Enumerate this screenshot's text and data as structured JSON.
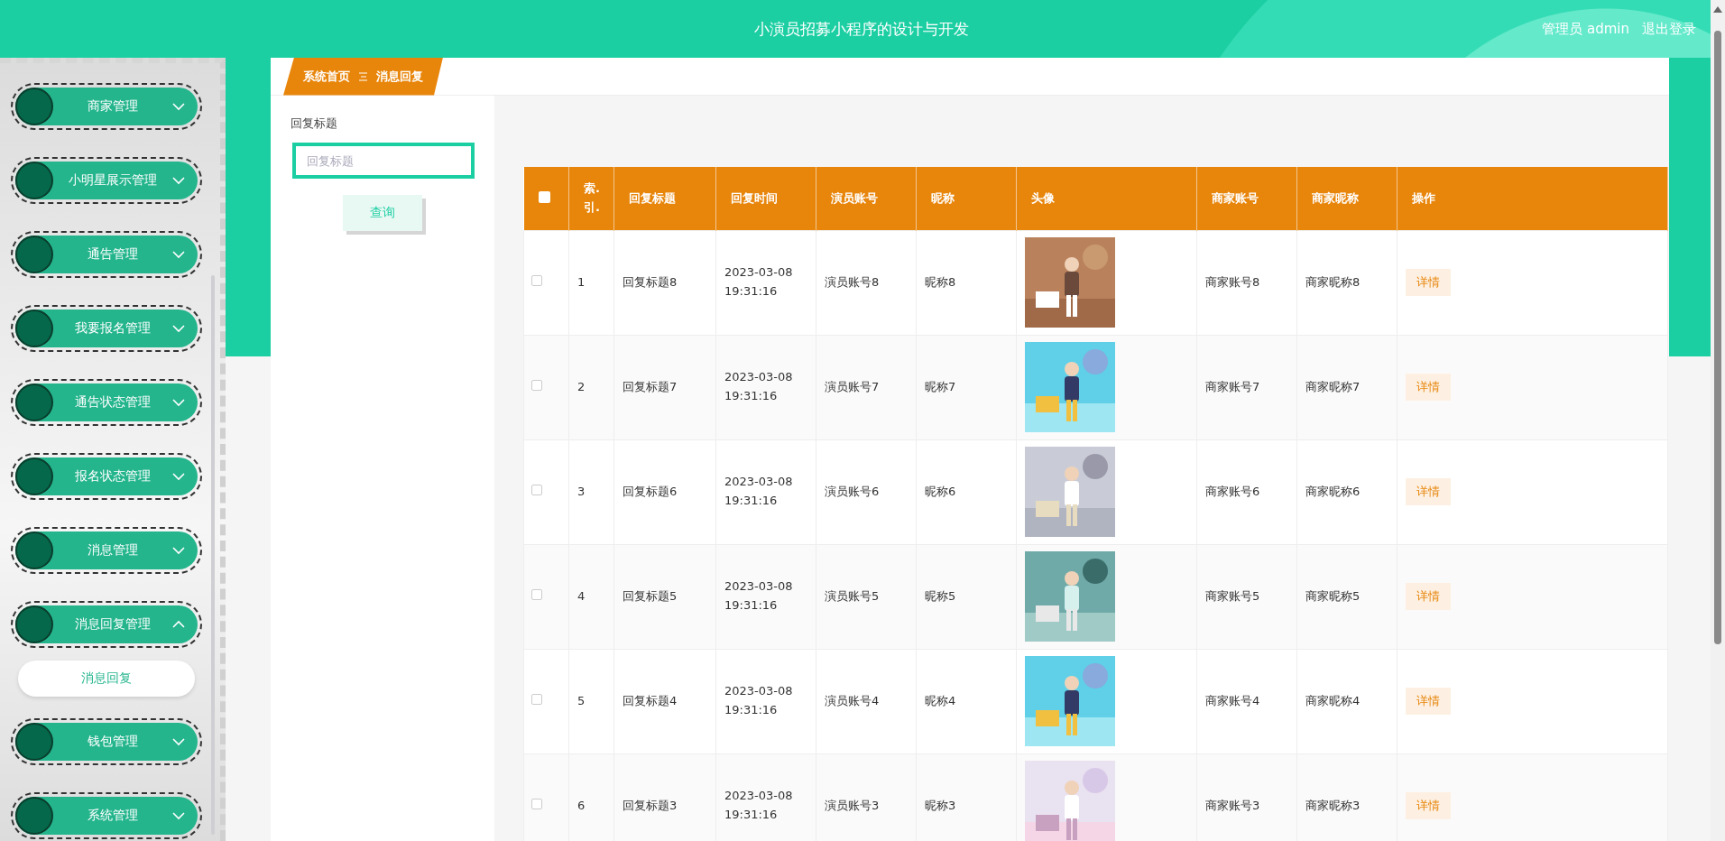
{
  "header": {
    "title": "小演员招募小程序的设计与开发",
    "user": "管理员 admin",
    "logout": "退出登录"
  },
  "sidebar": {
    "items": [
      {
        "label": "商家管理",
        "expanded": false
      },
      {
        "label": "小明星展示管理",
        "expanded": false
      },
      {
        "label": "通告管理",
        "expanded": false
      },
      {
        "label": "我要报名管理",
        "expanded": false
      },
      {
        "label": "通告状态管理",
        "expanded": false
      },
      {
        "label": "报名状态管理",
        "expanded": false
      },
      {
        "label": "消息管理",
        "expanded": false
      },
      {
        "label": "消息回复管理",
        "expanded": true,
        "children": [
          {
            "label": "消息回复",
            "selected": true
          }
        ]
      },
      {
        "label": "钱包管理",
        "expanded": false
      },
      {
        "label": "系统管理",
        "expanded": false
      }
    ]
  },
  "breadcrumb": [
    "系统首页",
    "消息回复"
  ],
  "search": {
    "label": "回复标题",
    "placeholder": "回复标题",
    "button": "查询"
  },
  "table": {
    "select_all": {
      "checked": false
    },
    "columns": [
      "索.引.",
      "回复标题",
      "回复时间",
      "演员账号",
      "昵称",
      "头像",
      "商家账号",
      "商家昵称",
      "操作"
    ],
    "rows": [
      {
        "checked": false,
        "index": "1",
        "title": "回复标题8",
        "time": "2023-03-08 19:31:16",
        "actor": "演员账号8",
        "nickname": "昵称8",
        "merchant": "商家账号8",
        "merchant_name": "商家昵称8",
        "action": "详情"
      },
      {
        "checked": false,
        "index": "2",
        "title": "回复标题7",
        "time": "2023-03-08 19:31:16",
        "actor": "演员账号7",
        "nickname": "昵称7",
        "merchant": "商家账号7",
        "merchant_name": "商家昵称7",
        "action": "详情"
      },
      {
        "checked": false,
        "index": "3",
        "title": "回复标题6",
        "time": "2023-03-08 19:31:16",
        "actor": "演员账号6",
        "nickname": "昵称6",
        "merchant": "商家账号6",
        "merchant_name": "商家昵称6",
        "action": "详情"
      },
      {
        "checked": false,
        "index": "4",
        "title": "回复标题5",
        "time": "2023-03-08 19:31:16",
        "actor": "演员账号5",
        "nickname": "昵称5",
        "merchant": "商家账号5",
        "merchant_name": "商家昵称5",
        "action": "详情"
      },
      {
        "checked": false,
        "index": "5",
        "title": "回复标题4",
        "time": "2023-03-08 19:31:16",
        "actor": "演员账号4",
        "nickname": "昵称4",
        "merchant": "商家账号4",
        "merchant_name": "商家昵称4",
        "action": "详情"
      },
      {
        "checked": false,
        "index": "6",
        "title": "回复标题3",
        "time": "2023-03-08 19:31:16",
        "actor": "演员账号3",
        "nickname": "昵称3",
        "merchant": "商家账号3",
        "merchant_name": "商家昵称3",
        "action": "详情"
      }
    ]
  }
}
